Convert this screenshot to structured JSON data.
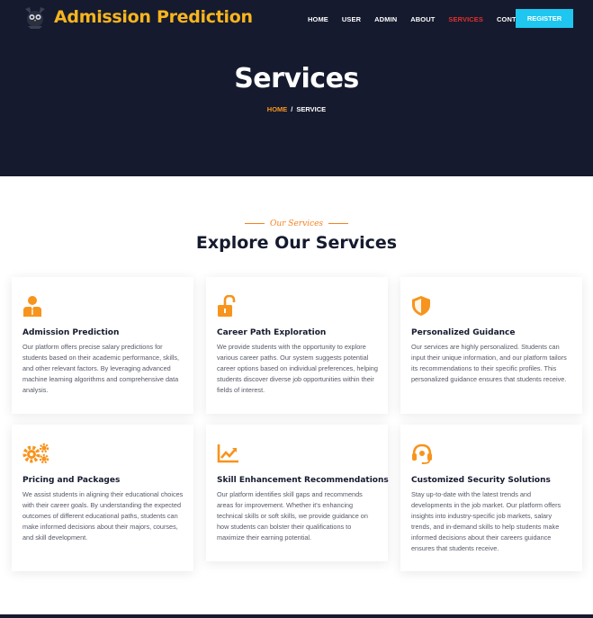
{
  "brand": {
    "name": "Admission Prediction",
    "logo_icon": "owl-logo-icon"
  },
  "nav": {
    "items": [
      "HOME",
      "USER",
      "ADMIN",
      "ABOUT",
      "SERVICES",
      "CONTACT"
    ],
    "active": "SERVICES",
    "register_label": "REGISTER"
  },
  "hero": {
    "title": "Services",
    "breadcrumb": {
      "home": "HOME",
      "separator": "/",
      "current": "SERVICE"
    }
  },
  "section": {
    "eyebrow": "Our Services",
    "title": "Explore Our Services"
  },
  "cards": [
    {
      "icon": "user-icon",
      "title": "Admission Prediction",
      "text": "Our platform offers precise salary predictions for students based on their academic performance, skills, and other relevant factors. By leveraging advanced machine learning algorithms and comprehensive data analysis."
    },
    {
      "icon": "unlock-icon",
      "title": "Career Path Exploration",
      "text": "We provide students with the opportunity to explore various career paths. Our system suggests potential career options based on individual preferences, helping students discover diverse job opportunities within their fields of interest."
    },
    {
      "icon": "shield-icon",
      "title": "Personalized Guidance",
      "text": "Our services are highly personalized. Students can input their unique information, and our platform tailors its recommendations to their specific profiles. This personalized guidance ensures that students receive."
    },
    {
      "icon": "gears-icon",
      "title": "Pricing and Packages",
      "text": "We assist students in aligning their educational choices with their career goals. By understanding the expected outcomes of different educational paths, students can make informed decisions about their majors, courses, and skill development."
    },
    {
      "icon": "chart-line-icon",
      "title": "Skill Enhancement Recommendations",
      "text": "Our platform identifies skill gaps and recommends areas for improvement. Whether it's enhancing technical skills or soft skills, we provide guidance on how students can bolster their qualifications to maximize their earning potential."
    },
    {
      "icon": "headset-icon",
      "title": "Customized Security Solutions",
      "text": "Stay up-to-date with the latest trends and developments in the job market. Our platform offers insights into industry-specific job markets, salary trends, and in-demand skills to help students make informed decisions about their careers guidance ensures that students receive."
    }
  ],
  "colors": {
    "accent": "#f7941d",
    "brand_yellow": "#f7b41e",
    "hero_bg": "#151a2e",
    "register_bg": "#1ec6f0",
    "active_nav": "#e0312b"
  }
}
